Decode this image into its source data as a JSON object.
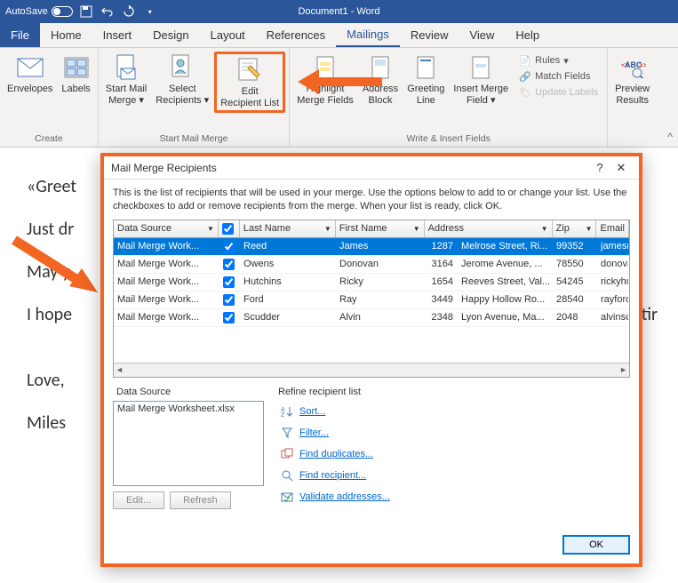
{
  "titlebar": {
    "autosave": "AutoSave",
    "doc_title": "Document1 - Word"
  },
  "tabs": {
    "file": "File",
    "home": "Home",
    "insert": "Insert",
    "design": "Design",
    "layout": "Layout",
    "references": "References",
    "mailings": "Mailings",
    "review": "Review",
    "view": "View",
    "help": "Help"
  },
  "ribbon": {
    "create": {
      "label": "Create",
      "envelopes": "Envelopes",
      "labels": "Labels"
    },
    "start": {
      "label": "Start Mail Merge",
      "start_mail_merge": "Start Mail\nMerge",
      "select_recipients": "Select\nRecipients",
      "edit_recipient_list": "Edit\nRecipient List"
    },
    "write": {
      "label": "Write & Insert Fields",
      "highlight": "Highlight\nMerge Fields",
      "address_block": "Address\nBlock",
      "greeting_line": "Greeting\nLine",
      "insert_merge_field": "Insert Merge\nField",
      "rules": "Rules",
      "match_fields": "Match Fields",
      "update_labels": "Update Labels"
    },
    "preview": {
      "preview_results": "Preview\nResults",
      "abc": "ABC"
    }
  },
  "doc_body": {
    "line1": "«Greet",
    "line2": "Just dr",
    "line3": "May y",
    "line4": "I hope",
    "line4_end": "tir",
    "line5": "Love,",
    "line6": "Miles "
  },
  "dialog": {
    "title": "Mail Merge Recipients",
    "desc": "This is the list of recipients that will be used in your merge.  Use the options below to add to or change your list.  Use the checkboxes to add or remove recipients from the merge.  When your list is ready, click OK.",
    "cols": {
      "data_source": "Data Source",
      "last_name": "Last Name",
      "first_name": "First Name",
      "address": "Address",
      "zip": "Zip",
      "email": "Email"
    },
    "rows": [
      {
        "ds": "Mail Merge Work...",
        "chk": true,
        "ln": "Reed",
        "fn": "James",
        "num": "1287",
        "addr": "Melrose Street, Ri...",
        "zip": "99352",
        "em": "jamesre"
      },
      {
        "ds": "Mail Merge Work...",
        "chk": true,
        "ln": "Owens",
        "fn": "Donovan",
        "num": "3164",
        "addr": "Jerome Avenue, ...",
        "zip": "78550",
        "em": "donova"
      },
      {
        "ds": "Mail Merge Work...",
        "chk": true,
        "ln": "Hutchins",
        "fn": "Ricky",
        "num": "1654",
        "addr": "Reeves Street, Val...",
        "zip": "54245",
        "em": "rickyhut"
      },
      {
        "ds": "Mail Merge Work...",
        "chk": true,
        "ln": "Ford",
        "fn": "Ray",
        "num": "3449",
        "addr": "Happy Hollow Ro...",
        "zip": "28540",
        "em": "rayford@"
      },
      {
        "ds": "Mail Merge Work...",
        "chk": true,
        "ln": "Scudder",
        "fn": "Alvin",
        "num": "2348",
        "addr": "Lyon Avenue, Ma...",
        "zip": "2048",
        "em": "alvinscu"
      }
    ],
    "data_source_label": "Data Source",
    "data_source_file": "Mail Merge Worksheet.xlsx",
    "edit_btn": "Edit...",
    "refresh_btn": "Refresh",
    "refine_label": "Refine recipient list",
    "refine": {
      "sort": "Sort...",
      "filter": "Filter...",
      "find_dup": "Find duplicates...",
      "find_rec": "Find recipient...",
      "validate": "Validate addresses..."
    },
    "ok": "OK"
  }
}
